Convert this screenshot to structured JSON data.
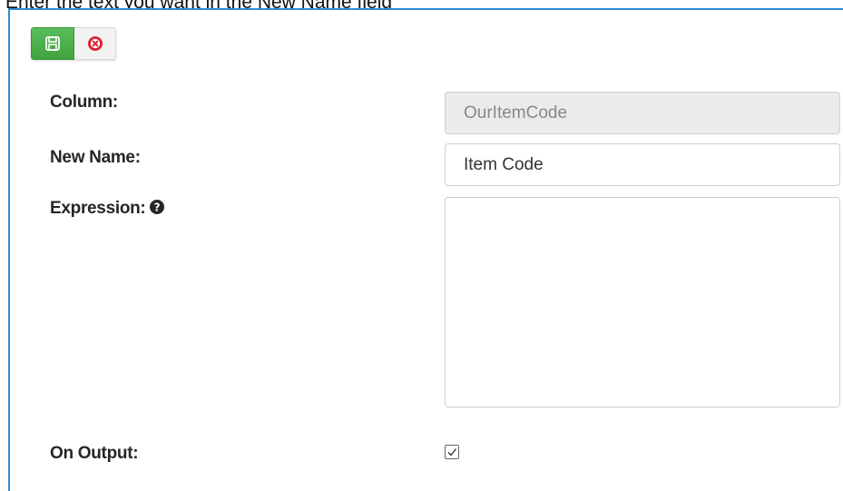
{
  "caption": "Enter the text you want in the New Name field",
  "toolbar": {
    "save_icon": "save-icon",
    "cancel_icon": "cancel-circle-icon"
  },
  "form": {
    "column_label": "Column:",
    "column_value": "OurItemCode",
    "new_name_label": "New Name:",
    "new_name_value": "Item Code",
    "expression_label": "Expression:",
    "expression_value": "",
    "on_output_label": "On Output:",
    "on_output_checked": true
  },
  "colors": {
    "accent_border": "#2a8fd4",
    "save_button": "#4cae4c",
    "cancel_icon": "#d9232e"
  }
}
